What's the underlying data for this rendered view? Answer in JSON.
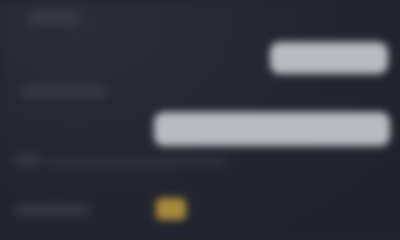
{
  "settings": {
    "rows": [
      {
        "label": "",
        "value": ""
      },
      {
        "label": "",
        "value": ""
      },
      {
        "label": "",
        "value": ""
      },
      {
        "label": "",
        "value": ""
      }
    ],
    "accent_color": "#a8893a",
    "background_color": "#22252f"
  }
}
